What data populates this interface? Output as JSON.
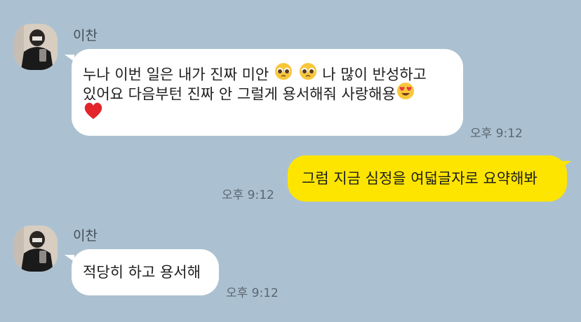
{
  "messages": [
    {
      "sender": "이찬",
      "lines": [
        [
          "누나 이번 일은 내가 진짜 미안 ",
          "pleading-face",
          "pleading-face",
          " 나 많이 반성하고"
        ],
        [
          "있어요 다음부턴 진짜 안 그럴게 용서해줘 사랑해용",
          "heart-eyes-face"
        ],
        [
          "red-heart"
        ]
      ],
      "time": "오후 9:12"
    },
    {
      "sender": "me",
      "text": "그럼 지금 심정을 여덟글자로 요약해봐",
      "time": "오후 9:12"
    },
    {
      "sender": "이찬",
      "text": "적당히 하고 용서해",
      "time": "오후 9:12"
    }
  ],
  "colors": {
    "background": "#abc1d1",
    "incoming": "#ffffff",
    "outgoing": "#fee500"
  }
}
